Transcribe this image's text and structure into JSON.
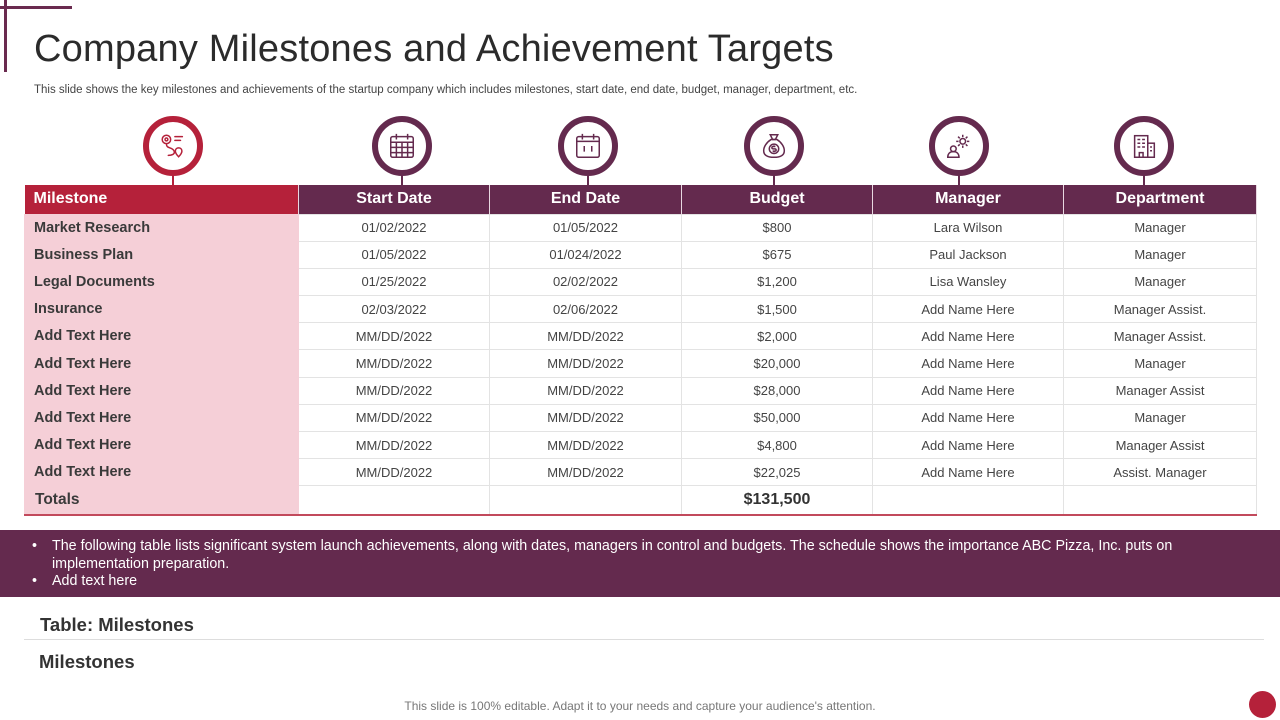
{
  "slide": {
    "title": "Company Milestones and Achievement Targets",
    "subtitle": "This slide shows the key milestones and achievements of the startup company which includes milestones, start date, end date, budget, manager, department, etc.",
    "footer_note": "This slide is 100% editable. Adapt it to your needs and capture your audience's attention."
  },
  "colors": {
    "accent_red": "#b5213a",
    "accent_plum": "#642a4e",
    "milestone_column_fill": "#f5cfd7"
  },
  "icons": [
    "roadmap-icon",
    "calendar-grid-icon",
    "calendar-icon",
    "money-bag-icon",
    "manager-gear-icon",
    "building-icon"
  ],
  "table": {
    "headers": [
      "Milestone",
      "Start Date",
      "End Date",
      "Budget",
      "Manager",
      "Department"
    ],
    "rows": [
      [
        "Market Research",
        "01/02/2022",
        "01/05/2022",
        "$800",
        "Lara Wilson",
        "Manager"
      ],
      [
        "Business Plan",
        "01/05/2022",
        "01/024/2022",
        "$675",
        "Paul Jackson",
        "Manager"
      ],
      [
        "Legal Documents",
        "01/25/2022",
        "02/02/2022",
        "$1,200",
        "Lisa Wansley",
        "Manager"
      ],
      [
        "Insurance",
        "02/03/2022",
        "02/06/2022",
        "$1,500",
        "Add Name Here",
        "Manager Assist."
      ],
      [
        "Add  Text Here",
        "MM/DD/2022",
        "MM/DD/2022",
        "$2,000",
        "Add Name Here",
        "Manager Assist."
      ],
      [
        "Add  Text Here",
        "MM/DD/2022",
        "MM/DD/2022",
        "$20,000",
        "Add Name Here",
        "Manager"
      ],
      [
        "Add  Text Here",
        "MM/DD/2022",
        "MM/DD/2022",
        "$28,000",
        "Add Name Here",
        "Manager Assist"
      ],
      [
        "Add  Text Here",
        "MM/DD/2022",
        "MM/DD/2022",
        "$50,000",
        "Add Name Here",
        "Manager"
      ],
      [
        "Add  Text Here",
        "MM/DD/2022",
        "MM/DD/2022",
        "$4,800",
        "Add Name Here",
        "Manager Assist"
      ],
      [
        "Add  Text Here",
        "MM/DD/2022",
        "MM/DD/2022",
        "$22,025",
        "Add Name Here",
        "Assist. Manager"
      ]
    ],
    "totals_label": "Totals",
    "totals_budget": "$131,500"
  },
  "banner": {
    "bullets": [
      "The following table lists significant system launch achievements, along with dates, managers in control and budgets. The schedule shows the importance ABC Pizza, Inc. puts on implementation preparation.",
      "Add text here"
    ]
  },
  "captions": {
    "table_caption": "Table: Milestones",
    "section_label": "Milestones"
  }
}
